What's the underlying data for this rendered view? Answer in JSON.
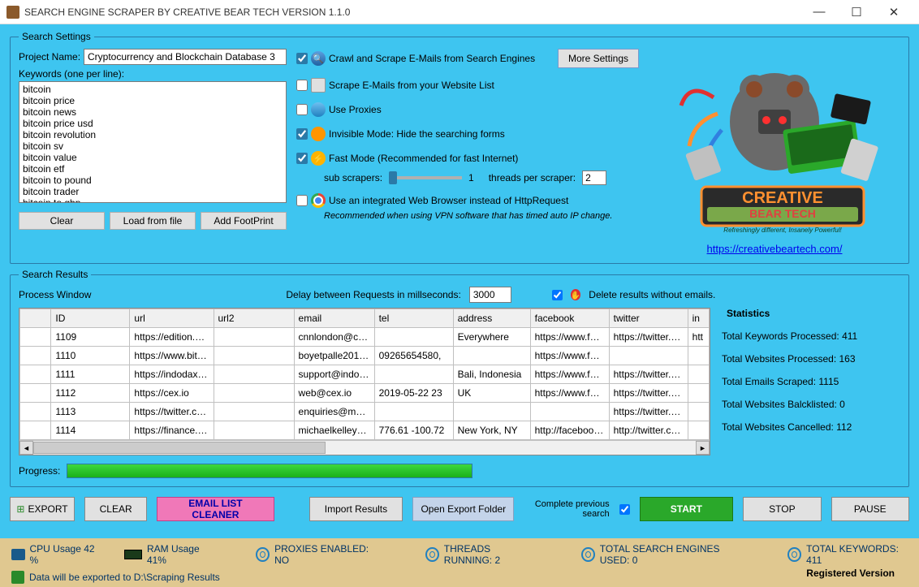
{
  "titlebar": {
    "title": "SEARCH ENGINE SCRAPER BY CREATIVE BEAR TECH VERSION 1.1.0"
  },
  "settings": {
    "legend": "Search Settings",
    "project_label": "Project Name:",
    "project_value": "Cryptocurrency and Blockchain Database 3",
    "keywords_label": "Keywords (one per line):",
    "keywords": "bitcoin\nbitcoin price\nbitcoin news\nbitcoin price usd\nbitcoin revolution\nbitcoin sv\nbitcoin value\nbitcoin etf\nbitcoin to pound\nbitcoin trader\nbitcoin to gbp",
    "btn_clear": "Clear",
    "btn_load": "Load from file",
    "btn_footprint": "Add FootPrint",
    "cb_crawl": "Crawl and Scrape E-Mails from Search Engines",
    "cb_crawl_checked": true,
    "btn_more": "More Settings",
    "cb_weblist": "Scrape E-Mails from your Website List",
    "cb_weblist_checked": false,
    "cb_proxies": "Use Proxies",
    "cb_proxies_checked": false,
    "cb_invisible": "Invisible Mode: Hide the searching forms",
    "cb_invisible_checked": true,
    "cb_fast": "Fast Mode (Recommended for fast Internet)",
    "cb_fast_checked": true,
    "sub_label": "sub scrapers:",
    "sub_value": "1",
    "threads_label": "threads per scraper:",
    "threads_value": "2",
    "cb_browser": "Use an integrated Web Browser instead of HttpRequest",
    "cb_browser_checked": false,
    "browser_note": "Recommended when using VPN software that has timed auto IP change.",
    "logo_link": "https://creativebeartech.com/"
  },
  "results": {
    "legend": "Search Results",
    "process_label": "Process Window",
    "delay_label": "Delay between Requests in millseconds:",
    "delay_value": "3000",
    "delete_label": "Delete results without emails.",
    "delete_checked": true,
    "headers": [
      "",
      "ID",
      "url",
      "url2",
      "email",
      "tel",
      "address",
      "facebook",
      "twitter",
      "in"
    ],
    "rows": [
      {
        "id": "1109",
        "url": "https://edition.cn...",
        "url2": "",
        "email": "cnnlondon@cnn...",
        "tel": "",
        "address": "Everywhere",
        "facebook": "https://www.fac...",
        "twitter": "https://twitter.co...",
        "in": "htt"
      },
      {
        "id": "1110",
        "url": "https://www.bitc...",
        "url2": "",
        "email": "boyetpalle2014@...",
        "tel": "09265654580,",
        "address": "",
        "facebook": "https://www.fac...",
        "twitter": "",
        "in": ""
      },
      {
        "id": "1111",
        "url": "https://indodax.c...",
        "url2": "",
        "email": "support@indodax...",
        "tel": "",
        "address": "Bali, Indonesia",
        "facebook": "https://www.fac...",
        "twitter": "https://twitter.co...",
        "in": ""
      },
      {
        "id": "1112",
        "url": "https://cex.io",
        "url2": "",
        "email": "web@cex.io",
        "tel": "2019-05-22 23",
        "address": "UK",
        "facebook": "https://www.fac...",
        "twitter": "https://twitter.co...",
        "in": ""
      },
      {
        "id": "1113",
        "url": "https://twitter.com",
        "url2": "",
        "email": "enquiries@mcsa...",
        "tel": "",
        "address": "",
        "facebook": "",
        "twitter": "https://twitter.co...",
        "in": ""
      },
      {
        "id": "1114",
        "url": "https://finance.y...",
        "url2": "",
        "email": "michaelkelley@y...",
        "tel": "776.61 -100.72",
        "address": "New York, NY",
        "facebook": "http://facebook...",
        "twitter": "http://twitter.com...",
        "in": ""
      }
    ],
    "stats_title": "Statistics",
    "stat_kw": "Total Keywords Processed: 411",
    "stat_web": "Total Websites Processed: 163",
    "stat_emails": "Total Emails Scraped: 1115",
    "stat_black": "Total Websites Balcklisted: 0",
    "stat_cancel": "Total Websites Cancelled: 112",
    "progress_label": "Progress:"
  },
  "buttons": {
    "export": "EXPORT",
    "clear": "CLEAR",
    "cleaner": "EMAIL LIST CLEANER",
    "import": "Import Results",
    "folder": "Open Export Folder",
    "complete": "Complete previous search",
    "complete_checked": true,
    "start": "START",
    "stop": "STOP",
    "pause": "PAUSE"
  },
  "status": {
    "cpu": "CPU Usage 42 %",
    "ram": "RAM Usage 41%",
    "proxies": "PROXIES ENABLED: NO",
    "threads": "THREADS RUNNING: 2",
    "engines": "TOTAL SEARCH ENGINES USED: 0",
    "keywords": "TOTAL KEYWORDS: 411",
    "export_path": "Data will be exported to D:\\Scraping Results",
    "registered": "Registered Version"
  }
}
